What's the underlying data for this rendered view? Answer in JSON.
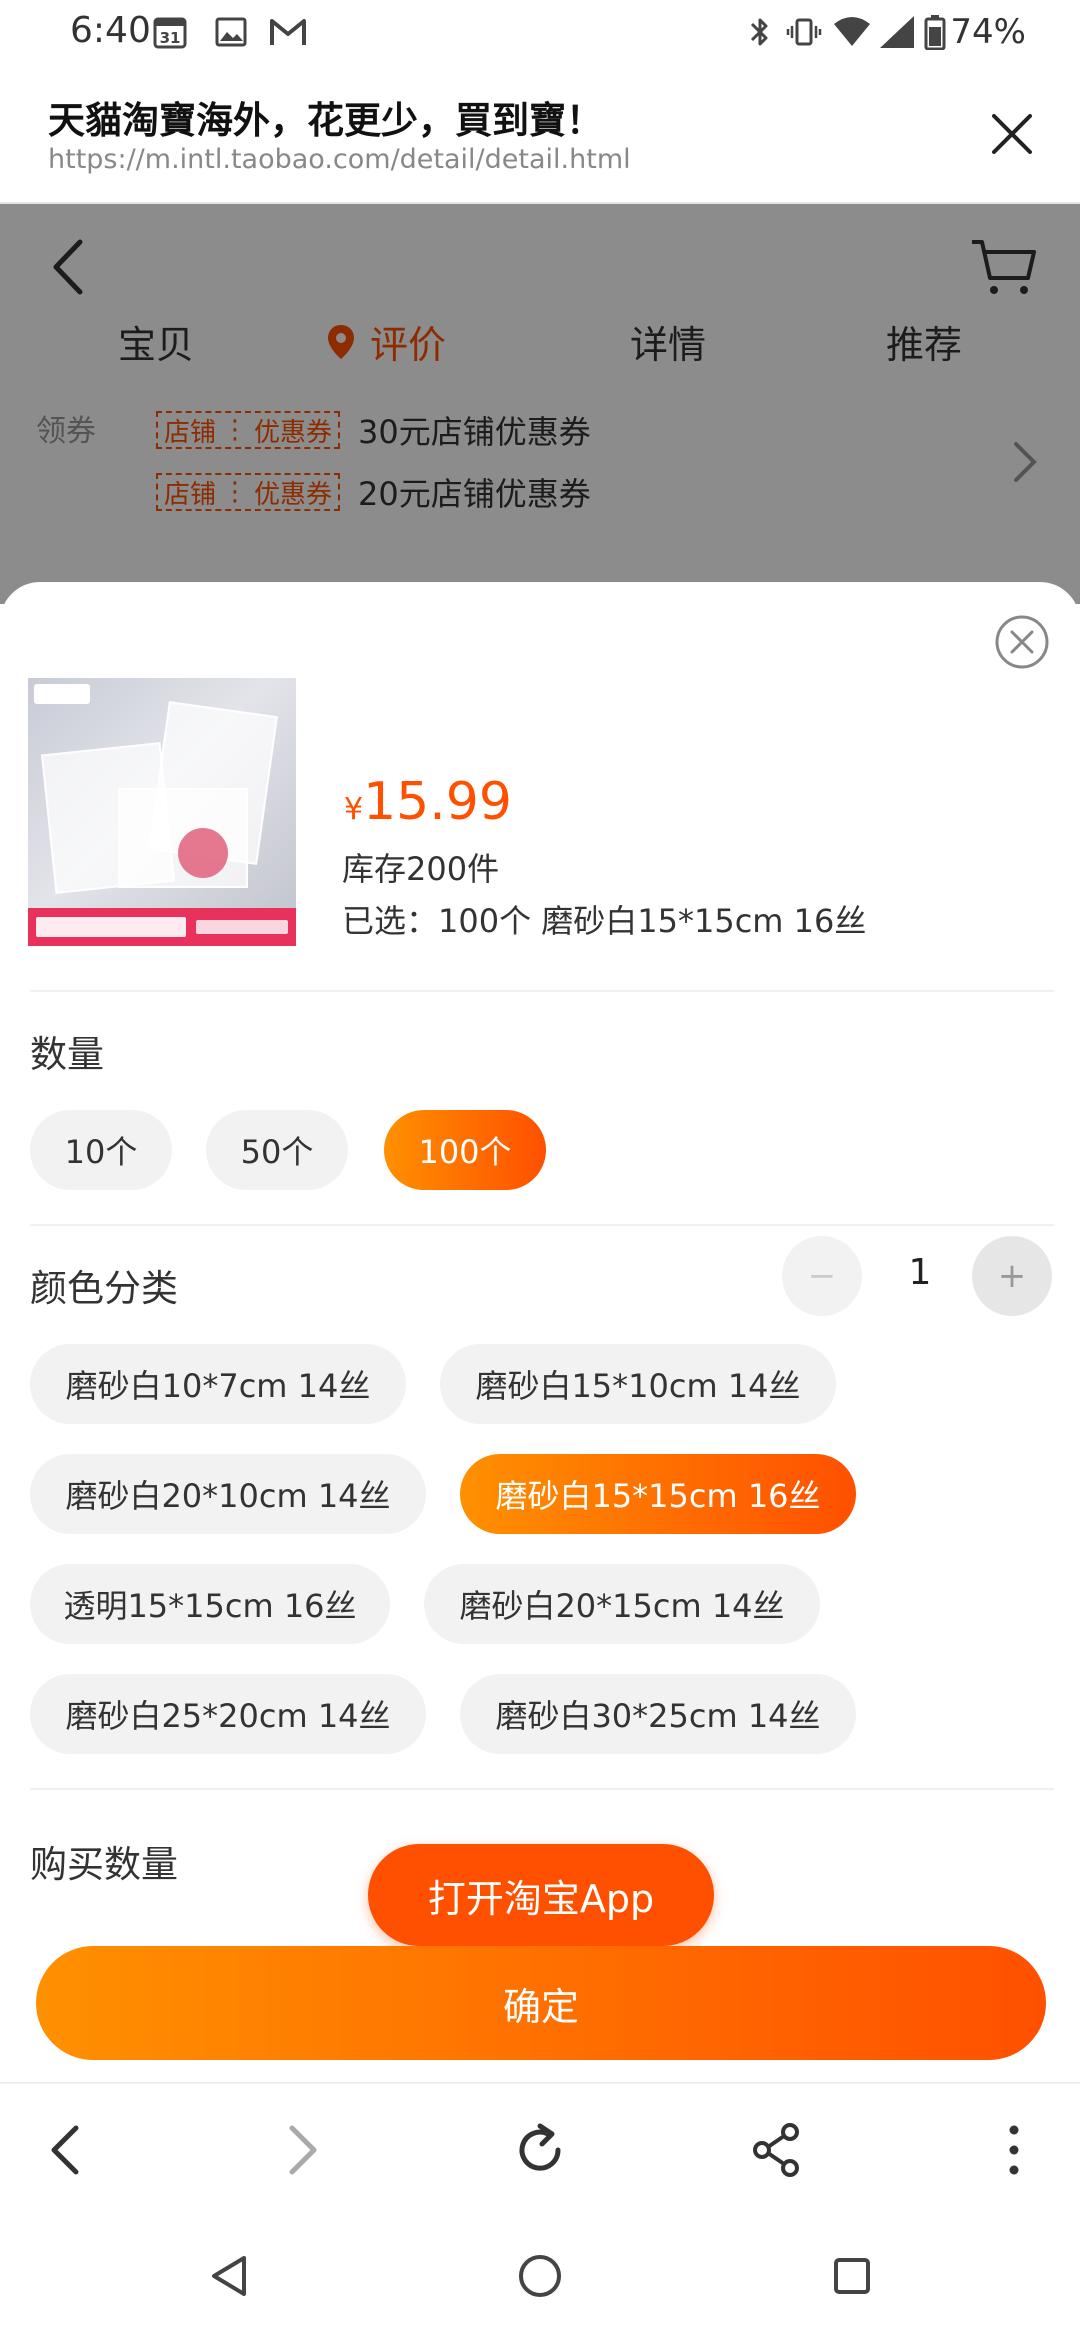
{
  "status_bar": {
    "time": "6:40",
    "calendar_day": "31",
    "battery": "74%",
    "icons": [
      "calendar-icon",
      "image-icon",
      "gmail-icon",
      "bluetooth-icon",
      "vibrate-icon",
      "wifi-icon",
      "signal-icon",
      "battery-icon"
    ]
  },
  "browser": {
    "title": "天貓淘寶海外，花更少，買到寶！",
    "url": "https://m.intl.taobao.com/detail/detail.html"
  },
  "page": {
    "tabs": [
      "宝贝",
      "评价",
      "详情",
      "推荐"
    ],
    "active_tab": "评价",
    "coupon_label": "领券",
    "coupon_tag_a": "店铺",
    "coupon_tag_b": "优惠券",
    "coupons": [
      "30元店铺优惠券",
      "20元店铺优惠券"
    ]
  },
  "sheet": {
    "price_symbol": "¥",
    "price": "15.99",
    "stock": "库存200件",
    "selected": "已选：100个 磨砂白15*15cm 16丝",
    "quantity_section": "数量",
    "quantity_options": [
      "10个",
      "50个",
      "100个"
    ],
    "quantity_selected": "100个",
    "color_section": "颜色分类",
    "color_options": [
      "磨砂白10*7cm 14丝",
      "磨砂白15*10cm 14丝",
      "磨砂白20*10cm 14丝",
      "磨砂白15*15cm 16丝",
      "透明15*15cm 16丝",
      "磨砂白20*15cm 14丝",
      "磨砂白25*20cm 14丝",
      "磨砂白30*25cm 14丝"
    ],
    "color_selected": "磨砂白15*15cm 16丝",
    "buy_qty_label": "购买数量",
    "buy_qty_value": "1",
    "minus": "−",
    "plus": "+",
    "open_app": "打开淘宝App",
    "confirm": "确定"
  },
  "colors": {
    "accent": "#ff5000",
    "accent_light": "#ff9000"
  }
}
